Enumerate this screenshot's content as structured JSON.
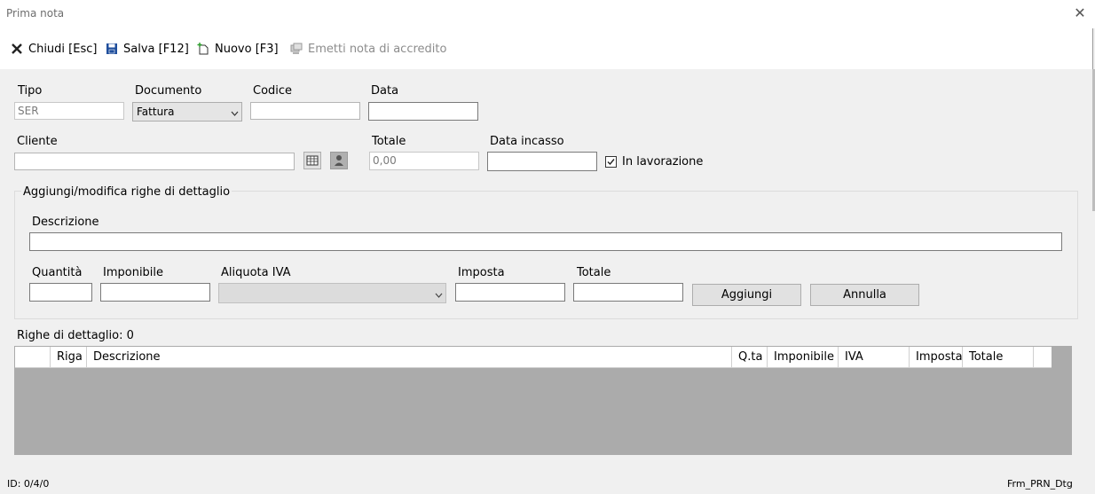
{
  "window": {
    "title": "Prima nota",
    "close_icon": "close-icon"
  },
  "toolbar": {
    "close_label": "Chiudi [Esc]",
    "save_label": "Salva [F12]",
    "new_label": "Nuovo [F3]",
    "credit_note_label": "Emetti nota di accredito"
  },
  "form": {
    "tipo_label": "Tipo",
    "tipo_value": "SER",
    "documento_label": "Documento",
    "documento_value": "Fattura",
    "codice_label": "Codice",
    "codice_value": "",
    "data_label": "Data",
    "data_value": "",
    "cliente_label": "Cliente",
    "cliente_value": "",
    "totale_label": "Totale",
    "totale_value": "0,00",
    "data_incasso_label": "Data incasso",
    "data_incasso_value": "",
    "in_lavorazione_label": "In lavorazione",
    "in_lavorazione_checked": true
  },
  "detail_group": {
    "title": "Aggiungi/modifica righe di dettaglio",
    "descrizione_label": "Descrizione",
    "quantita_label": "Quantità",
    "imponibile_label": "Imponibile",
    "aliquota_label": "Aliquota IVA",
    "imposta_label": "Imposta",
    "totale_label": "Totale",
    "add_button": "Aggiungi",
    "cancel_button": "Annulla"
  },
  "grid": {
    "count_label": "Righe di dettaglio: 0",
    "columns": [
      "",
      "Riga",
      "Descrizione",
      "Q.ta",
      "Imponibile",
      "IVA",
      "Imposta",
      "Totale"
    ]
  },
  "status": {
    "left": "ID: 0/4/0",
    "right": "Frm_PRN_Dtg"
  }
}
